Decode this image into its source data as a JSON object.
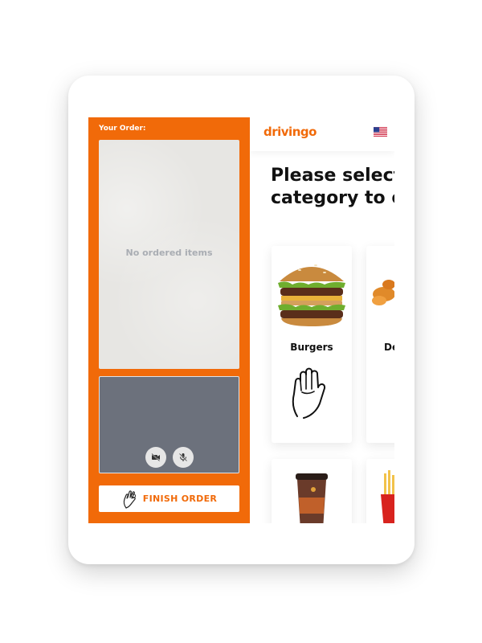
{
  "order": {
    "title": "Your Order:",
    "empty_message": "No ordered items",
    "finish_label": "FINISH ORDER"
  },
  "header": {
    "brand": "drivingo",
    "language_flag": "us-flag-icon"
  },
  "main": {
    "heading_line1": "Please select",
    "heading_line2": "category to o",
    "categories": [
      {
        "label": "Burgers"
      },
      {
        "label": "De"
      }
    ]
  },
  "colors": {
    "accent": "#f16a09",
    "video_bg": "#6c717c",
    "panel_gray": "#e7e6e3"
  }
}
